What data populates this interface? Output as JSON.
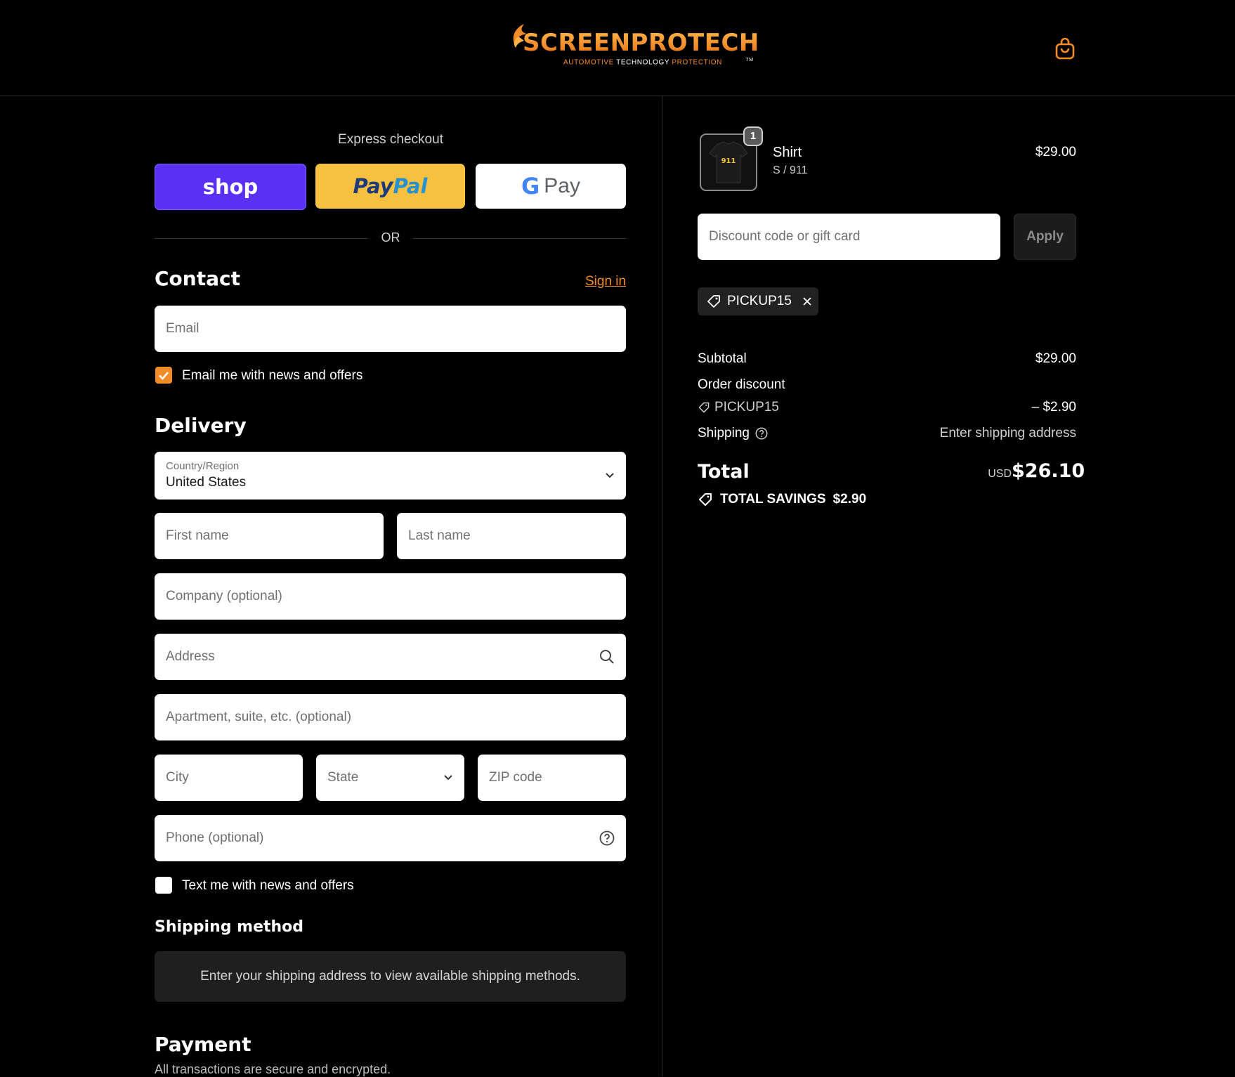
{
  "brand": {
    "logo_word": "SCREENPROTECH",
    "tagline_1": "AUTOMOTIVE",
    "tagline_2": "TECHNOLOGY",
    "tagline_3": "PROTECTION",
    "tm": "TM",
    "accent_color": "#f28c28"
  },
  "header": {
    "cart_icon": "shopping-bag-icon"
  },
  "express": {
    "title": "Express checkout",
    "shop_label": "shop",
    "paypal_label_1": "Pay",
    "paypal_label_2": "Pal",
    "gpay_g": "G",
    "gpay_label": "Pay",
    "divider_text": "OR"
  },
  "contact": {
    "heading": "Contact",
    "sign_in": "Sign in",
    "email_placeholder": "Email",
    "newsletter_label": "Email me with news and offers",
    "newsletter_checked": true
  },
  "delivery": {
    "heading": "Delivery",
    "country_label": "Country/Region",
    "country_value": "United States",
    "first_name_placeholder": "First name",
    "last_name_placeholder": "Last name",
    "company_placeholder": "Company (optional)",
    "address_placeholder": "Address",
    "apartment_placeholder": "Apartment, suite, etc. (optional)",
    "city_placeholder": "City",
    "state_placeholder": "State",
    "zip_placeholder": "ZIP code",
    "phone_placeholder": "Phone (optional)",
    "sms_label": "Text me with news and offers",
    "sms_checked": false
  },
  "shipping_method": {
    "heading": "Shipping method",
    "note": "Enter your shipping address to view available shipping methods."
  },
  "payment": {
    "heading": "Payment",
    "note": "All transactions are secure and encrypted."
  },
  "summary": {
    "item": {
      "name": "Shirt",
      "variant": "S / 911",
      "price": "$29.00",
      "quantity": "1",
      "thumb_text": "911"
    },
    "discount_placeholder": "Discount code or gift card",
    "apply_label": "Apply",
    "applied_code": "PICKUP15",
    "subtotal_label": "Subtotal",
    "subtotal_value": "$29.00",
    "order_discount_label": "Order discount",
    "discount_code": "PICKUP15",
    "discount_value": "– $2.90",
    "shipping_label": "Shipping",
    "shipping_value": "Enter shipping address",
    "total_label": "Total",
    "currency": "USD",
    "total_value": "$26.10",
    "savings_label": "TOTAL SAVINGS",
    "savings_value": "$2.90"
  }
}
